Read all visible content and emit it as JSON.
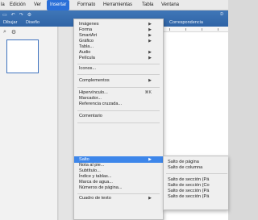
{
  "menubar": {
    "items": [
      "la",
      "Edición",
      "Ver",
      "Insertar",
      "Formato",
      "Herramientas",
      "Tabla",
      "Ventana"
    ]
  },
  "ribbon": {
    "tabs": [
      "Dibujar",
      "Diseño",
      "Correspondencia"
    ],
    "top_right": "D"
  },
  "insert_menu": {
    "items": [
      {
        "label": "Imágenes",
        "arrow": "▶"
      },
      {
        "label": "Forma",
        "arrow": "▶"
      },
      {
        "label": "SmartArt",
        "arrow": "▶"
      },
      {
        "label": "Gráfico",
        "arrow": "▶"
      },
      {
        "label": "Tabla...",
        "arrow": ""
      },
      {
        "label": "Audio",
        "arrow": "▶"
      },
      {
        "label": "Película",
        "arrow": "▶"
      },
      {
        "label": "Iconos...",
        "arrow": ""
      },
      {
        "label": "Complementos",
        "arrow": "▶"
      },
      {
        "label": "Hipervínculo...",
        "shortcut": "⌘K"
      },
      {
        "label": "Marcador...",
        "arrow": ""
      },
      {
        "label": "Referencia cruzada...",
        "arrow": ""
      },
      {
        "label": "Comentario",
        "arrow": ""
      },
      {
        "label": "Salto",
        "arrow": "▶"
      },
      {
        "label": "Nota al pie...",
        "arrow": ""
      },
      {
        "label": "Subtítulo...",
        "arrow": ""
      },
      {
        "label": "Índice y tablas...",
        "arrow": ""
      },
      {
        "label": "Marca de agua...",
        "arrow": ""
      },
      {
        "label": "Números de página...",
        "arrow": ""
      },
      {
        "label": "Cuadro de texto",
        "arrow": "▶"
      }
    ]
  },
  "break_submenu": {
    "items": [
      "Salto de página",
      "Salto de columna",
      "Salto de sección (Pá",
      "Salto de sección (Co",
      "Salto de sección (Pá",
      "Salto de sección (Pá"
    ]
  },
  "colors": {
    "menu_highlight": "#3d86ea",
    "menubar_active": "#2a6fd8",
    "ribbon": "#3f76b7"
  }
}
